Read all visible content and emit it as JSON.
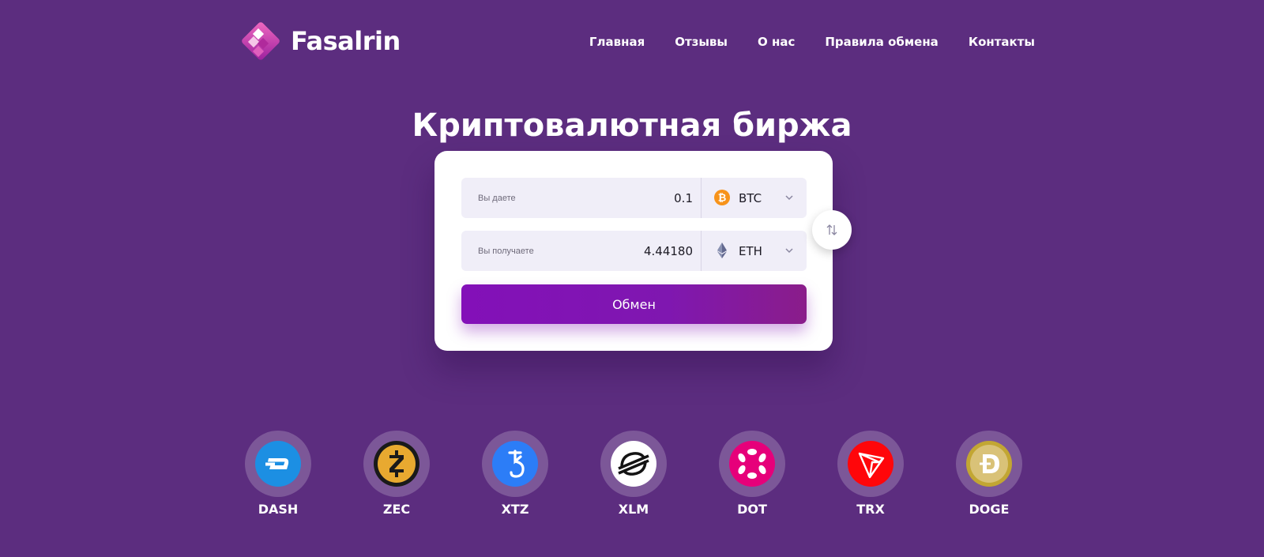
{
  "brand": {
    "name": "Fasalrin",
    "accent": "#d63aa8"
  },
  "nav": [
    {
      "label": "Главная"
    },
    {
      "label": "Отзывы"
    },
    {
      "label": "О нас"
    },
    {
      "label": "Правила обмена"
    },
    {
      "label": "Контакты"
    }
  ],
  "hero": {
    "title": "Криптовалютная биржа"
  },
  "exchange": {
    "give": {
      "label": "Вы даете",
      "amount": "0.1",
      "currency": "BTC",
      "icon": "bitcoin-icon"
    },
    "get": {
      "label": "Вы получаете",
      "amount": "4.44180",
      "currency": "ETH",
      "icon": "ethereum-icon"
    },
    "submit_label": "Обмен",
    "swap_icon": "swap-arrows-icon"
  },
  "coins": [
    {
      "code": "DASH",
      "icon": "dash-icon",
      "color": "#1c8fe3"
    },
    {
      "code": "ZEC",
      "icon": "zcash-icon",
      "color": "#e8a930"
    },
    {
      "code": "XTZ",
      "icon": "tezos-icon",
      "color": "#2c7df7"
    },
    {
      "code": "XLM",
      "icon": "stellar-icon",
      "color": "#ffffff"
    },
    {
      "code": "DOT",
      "icon": "polkadot-icon",
      "color": "#e6007a"
    },
    {
      "code": "TRX",
      "icon": "tron-icon",
      "color": "#ff060a"
    },
    {
      "code": "DOGE",
      "icon": "dogecoin-icon",
      "color": "#c2a633"
    }
  ]
}
